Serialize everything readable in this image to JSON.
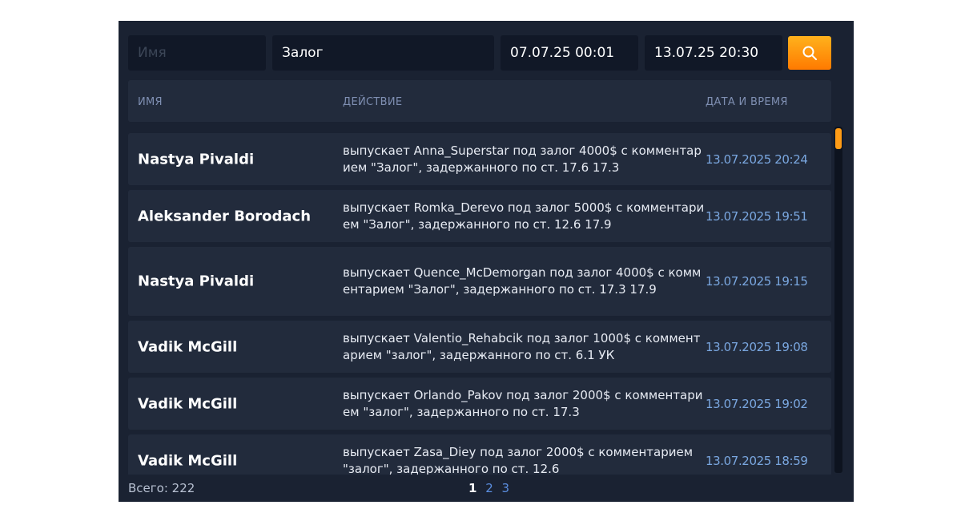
{
  "filters": {
    "name_placeholder": "Имя",
    "name_value": "",
    "action_value": "Залог",
    "date_from": "07.07.25 00:01",
    "date_to": "13.07.25 20:30",
    "search_icon": "search-icon",
    "search_color": "#ff8c00"
  },
  "table": {
    "headers": {
      "name": "ИМЯ",
      "action": "ДЕЙСТВИЕ",
      "datetime": "ДАТА И ВРЕМЯ"
    },
    "rows": [
      {
        "name": "Nastya Pivaldi",
        "action": "выпускает Anna_Superstar под залог 4000$ с комментарием \"Залог\", задержанного по ст. 17.6 17.3",
        "datetime": "13.07.2025 20:24"
      },
      {
        "name": "Aleksander Borodach",
        "action": "выпускает Romka_Derevo под залог 5000$ с комментарием \"Залог\", задержанного по ст. 12.6 17.9",
        "datetime": "13.07.2025 19:51"
      },
      {
        "name": "Nastya Pivaldi",
        "action": "выпускает Quence_McDemorgan под залог 4000$ с комментарием \"Залог\", задержанного по ст. 17.3 17.9",
        "datetime": "13.07.2025 19:15"
      },
      {
        "name": "Vadik McGill",
        "action": "выпускает Valentio_Rehabcik под залог 1000$ с комментарием \"залог\", задержанного по ст. 6.1 УК",
        "datetime": "13.07.2025 19:08"
      },
      {
        "name": "Vadik McGill",
        "action": "выпускает Orlando_Pakov под залог 2000$ с комментарием \"залог\", задержанного по ст. 17.3",
        "datetime": "13.07.2025 19:02"
      },
      {
        "name": "Vadik McGill",
        "action": "выпускает Zasa_Diey под залог 2000$ с комментарием \"залог\", задержанного по ст. 12.6",
        "datetime": "13.07.2025 18:59"
      }
    ]
  },
  "footer": {
    "total": "Всего: 222",
    "pages": [
      "1",
      "2",
      "3"
    ],
    "current_page": "1"
  },
  "colors": {
    "panel_bg": "#1a2232",
    "row_bg": "#222b3c",
    "input_bg": "#111827",
    "accent": "#ff9c16",
    "date_text": "#7aa7e0",
    "page_link": "#5b8ee0"
  }
}
